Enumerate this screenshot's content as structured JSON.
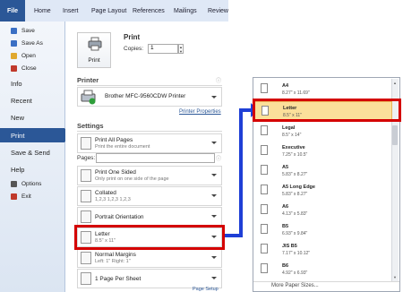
{
  "ribbon": {
    "file": "File",
    "tabs": [
      "Home",
      "Insert",
      "Page Layout",
      "References",
      "Mailings",
      "Review"
    ]
  },
  "nav": {
    "small": [
      {
        "label": "Save",
        "color": "#3a6fc4"
      },
      {
        "label": "Save As",
        "color": "#3a6fc4"
      },
      {
        "label": "Open",
        "color": "#e0a82e"
      },
      {
        "label": "Close",
        "color": "#c0392b"
      }
    ],
    "large": [
      "Info",
      "Recent",
      "New",
      "Print",
      "Save & Send",
      "Help"
    ],
    "bottom": [
      {
        "label": "Options",
        "color": "#555555"
      },
      {
        "label": "Exit",
        "color": "#c0392b"
      }
    ],
    "active": "Print"
  },
  "print": {
    "title": "Print",
    "button_label": "Print",
    "copies_label": "Copies:",
    "copies_value": "1"
  },
  "printer": {
    "section": "Printer",
    "name": "Brother MFC-9560CDW Printer",
    "properties_link": "Printer Properties"
  },
  "settings": {
    "section": "Settings",
    "items": [
      {
        "title": "Print All Pages",
        "sub": "Print the entire document"
      },
      {
        "title": "Print One Sided",
        "sub": "Only print on one side of the page"
      },
      {
        "title": "Collated",
        "sub": "1,2,3   1,2,3   1,2,3"
      },
      {
        "title": "Portrait Orientation",
        "sub": ""
      },
      {
        "title": "Letter",
        "sub": "8.5\" x 11\""
      },
      {
        "title": "Normal Margins",
        "sub": "Left: 1\"   Right: 1\""
      },
      {
        "title": "1 Page Per Sheet",
        "sub": ""
      }
    ],
    "pages_label": "Pages:",
    "page_setup_link": "Page Setup"
  },
  "paper_sizes": {
    "items": [
      {
        "name": "A4",
        "size": "8.27\" x 11.69\""
      },
      {
        "name": "Letter",
        "size": "8.5\" x 11\""
      },
      {
        "name": "Legal",
        "size": "8.5\" x 14\""
      },
      {
        "name": "Executive",
        "size": "7.25\" x 10.5\""
      },
      {
        "name": "A5",
        "size": "5.83\" x 8.27\""
      },
      {
        "name": "A5 Long Edge",
        "size": "5.83\" x 8.27\""
      },
      {
        "name": "A6",
        "size": "4.13\" x 5.83\""
      },
      {
        "name": "B5",
        "size": "6.93\" x 9.84\""
      },
      {
        "name": "JIS B5",
        "size": "7.17\" x 10.12\""
      },
      {
        "name": "B6",
        "size": "4.92\" x 6.93\""
      }
    ],
    "selected": "Letter",
    "more": "More Paper Sizes..."
  },
  "colors": {
    "accent": "#2b5797",
    "highlight": "#d40000",
    "arrow": "#1f3fd6",
    "selected_bg": "#fbe09a"
  }
}
